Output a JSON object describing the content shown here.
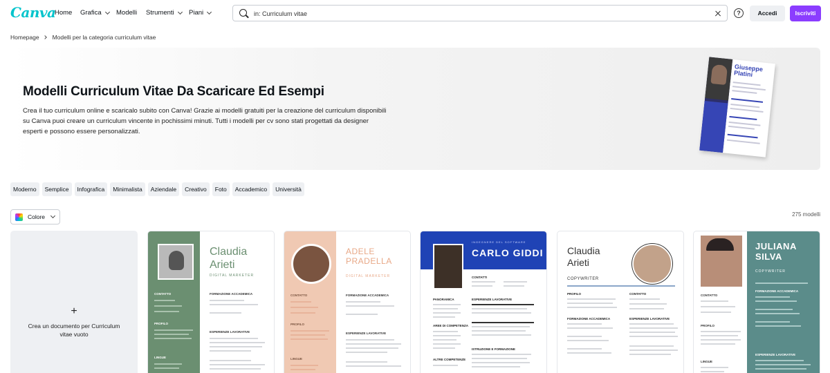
{
  "nav": {
    "logo": "Canva",
    "items": [
      {
        "label": "Home",
        "has_menu": false
      },
      {
        "label": "Grafica",
        "has_menu": true
      },
      {
        "label": "Modelli",
        "has_menu": false
      },
      {
        "label": "Strumenti",
        "has_menu": true
      },
      {
        "label": "Piani",
        "has_menu": true
      }
    ],
    "search_value": "in: Curriculum vitae",
    "help_label": "?",
    "login_label": "Accedi",
    "signup_label": "Iscriviti"
  },
  "breadcrumb": {
    "home": "Homepage",
    "current": "Modelli per la categoria curriculum vitae"
  },
  "hero": {
    "title": "Modelli Curriculum Vitae Da Scaricare Ed Esempi",
    "description": "Crea il tuo curriculum online e scaricalo subito con Canva! Grazie ai modelli gratuiti per la creazione del curriculum disponibili su Canva puoi creare un curriculum vincente in pochissimi minuti. Tutti i modelli per cv sono stati progettati da designer esperti e possono essere personalizzati.",
    "preview_name": "Giuseppe Platini"
  },
  "filters": {
    "chips": [
      "Moderno",
      "Semplice",
      "Infografica",
      "Minimalista",
      "Aziendale",
      "Creativo",
      "Foto",
      "Accademico",
      "Università"
    ],
    "color_label": "Colore",
    "count_label": "275 modelli"
  },
  "create_card": {
    "plus": "+",
    "label": "Crea un documento per Curriculum vitae vuoto"
  },
  "templates": [
    {
      "name_line1": "Claudia",
      "name_line2": "Arieti",
      "role": "DIGITAL MARKETER",
      "sections": [
        "CONTATTO",
        "PROFILO",
        "LINGUE",
        "FORMAZIONE ACCADEMICA",
        "ESPERIENZE LAVORATIVE"
      ]
    },
    {
      "name_line1": "ADELE",
      "name_line2": "PRADELLA",
      "role": "DIGITAL MARKETER",
      "sections": [
        "CONTATTO",
        "PROFILO",
        "LINGUE",
        "FORMAZIONE ACCADEMICA",
        "ESPERIENZE LAVORATIVE"
      ]
    },
    {
      "name": "CARLO GIDDI",
      "role": "INGEGNERE DEL SOFTWARE",
      "sections": [
        "CONTATTI",
        "PANORAMICA",
        "AREE DI COMPETENZA",
        "ALTRE COMPETENZE",
        "ESPERIENZE LAVORATIVE",
        "ISTRUZIONE E FORMAZIONE"
      ]
    },
    {
      "name_line1": "Claudia",
      "name_line2": "Arieti",
      "role": "COPYWRITER",
      "sections": [
        "PROFILO",
        "FORMAZIONE ACCADEMICA",
        "CONTATTO",
        "ESPERIENZE LAVORATIVE"
      ]
    },
    {
      "name_line1": "JULIANA",
      "name_line2": "SILVA",
      "role": "COPYWRITER",
      "sections": [
        "CONTATTO",
        "PROFILO",
        "LINGUE",
        "FORMAZIONE ACCADEMICA",
        "ESPERIENZE LAVORATIVE"
      ]
    }
  ],
  "colors": {
    "brand": "#00c4cc",
    "primary": "#8b3dff",
    "green": "#6b8f71",
    "peach": "#f0c9b3",
    "blue": "#1f43b5",
    "teal": "#5b8c8a"
  }
}
